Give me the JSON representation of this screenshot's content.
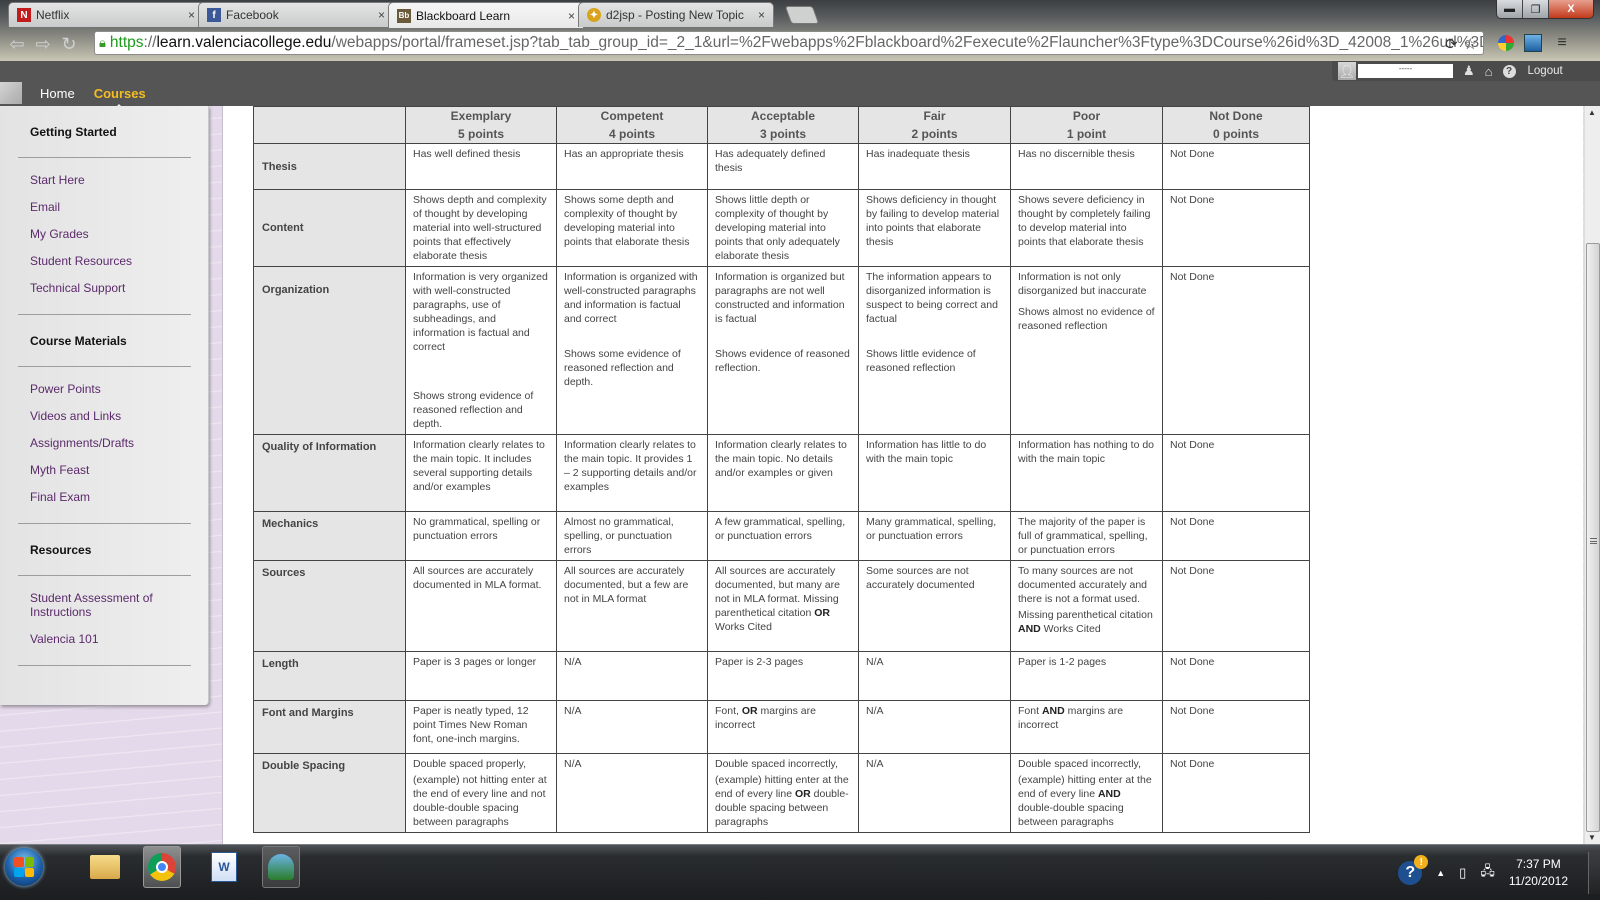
{
  "browser": {
    "tabs": [
      {
        "label": "Netflix",
        "icon": "netflix-icon",
        "active": false
      },
      {
        "label": "Facebook",
        "icon": "facebook-icon",
        "active": false
      },
      {
        "label": "Blackboard Learn",
        "icon": "blackboard-icon",
        "active": true
      },
      {
        "label": "d2jsp - Posting New Topic",
        "icon": "d2jsp-icon",
        "active": false
      }
    ],
    "tab_close": "×",
    "url": {
      "scheme": "https",
      "rest_scheme": "://",
      "host": "learn.valenciacollege.edu",
      "path": "/webapps/portal/frameset.jsp?tab_tab_group_id=_2_1&url=%2Fwebapps%2Fblackboard%2Fexecute%2Flauncher%3Ftype%3DCourse%26id%3D_42008_1%26url%3D"
    },
    "window_controls": {
      "minimize": "▬",
      "maximize": "❐",
      "close": "X"
    }
  },
  "blackboard": {
    "nav": [
      {
        "label": "Home",
        "active": false
      },
      {
        "label": "Courses",
        "active": true
      }
    ],
    "user_name": "-----",
    "logout_label": "Logout"
  },
  "sidebar": {
    "groups": [
      {
        "heading": "Getting Started",
        "items": [
          "Start Here",
          "Email",
          "My Grades",
          "Student Resources",
          "Technical Support"
        ]
      },
      {
        "heading": "Course Materials",
        "items": [
          "Power Points",
          "Videos and Links",
          "Assignments/Drafts",
          "Myth Feast",
          "Final Exam"
        ]
      },
      {
        "heading": "Resources",
        "items": [
          "Student Assessment of Instructions",
          "Valencia 101"
        ]
      }
    ]
  },
  "rubric": {
    "columns": [
      {
        "level": "Exemplary",
        "points": "5 points"
      },
      {
        "level": "Competent",
        "points": "4 points"
      },
      {
        "level": "Acceptable",
        "points": "3 points"
      },
      {
        "level": "Fair",
        "points": "2 points"
      },
      {
        "level": "Poor",
        "points": "1 point"
      },
      {
        "level": "Not Done",
        "points": "0 points"
      }
    ],
    "rows": [
      {
        "criterion": "Thesis",
        "cells": [
          "Has well defined thesis",
          "Has an appropriate thesis",
          "Has adequately defined thesis",
          "Has inadequate thesis",
          "Has no discernible thesis",
          "Not Done"
        ]
      },
      {
        "criterion": "Content",
        "cells": [
          "Shows depth and complexity of thought by developing material into well-structured points that effectively elaborate thesis",
          "Shows some depth and complexity of thought by developing material into points that elaborate thesis",
          "Shows little depth or complexity of thought by developing material into points that only adequately elaborate thesis",
          "Shows deficiency in thought by failing to develop material into points that elaborate thesis",
          "Shows severe deficiency in thought by completely failing to develop material into points that elaborate thesis",
          "Not Done"
        ]
      },
      {
        "criterion": "Organization",
        "cells": [
          [
            "Information is very organized with well-constructed paragraphs, use of subheadings, and information is factual and correct",
            "Shows strong evidence of reasoned reflection and depth."
          ],
          [
            "Information is organized with well-constructed paragraphs and information is factual and correct",
            "Shows some evidence of reasoned reflection and depth."
          ],
          [
            "Information is organized but paragraphs are not well constructed and information is factual",
            "Shows evidence of reasoned reflection."
          ],
          [
            "The information appears to disorganized information is suspect to being correct and factual",
            "Shows little evidence of reasoned reflection"
          ],
          [
            "Information is not only disorganized but inaccurate",
            "Shows almost no evidence of reasoned reflection"
          ],
          [
            "Not Done"
          ]
        ]
      },
      {
        "criterion": "Quality of Information",
        "cells": [
          "Information clearly relates to the main topic. It includes several supporting details and/or examples",
          "Information clearly relates to the main topic. It provides 1 – 2 supporting details and/or examples",
          "Information clearly relates to the main topic. No details and/or examples or given",
          "Information has little to do with the main topic",
          "Information has nothing to do with the main topic",
          "Not Done"
        ]
      },
      {
        "criterion": "Mechanics",
        "cells": [
          "No grammatical, spelling or punctuation errors",
          "Almost no grammatical, spelling, or punctuation errors",
          "A few grammatical, spelling, or punctuation errors",
          "Many grammatical, spelling, or punctuation errors",
          "The majority of the paper is full of grammatical, spelling, or punctuation errors",
          "Not Done"
        ]
      },
      {
        "criterion": "Sources",
        "cells": [
          "All sources are accurately documented in MLA format.",
          "All sources are accurately documented, but a few are not in MLA format",
          "All sources are accurately documented, but many are not in MLA format. Missing parenthetical citation OR Works Cited",
          "Some sources are not accurately documented",
          "To many sources are not documented accurately and there is not a format used.|Missing parenthetical citation AND Works Cited",
          "Not Done"
        ]
      },
      {
        "criterion": "Length",
        "cells": [
          "Paper is 3 pages or longer",
          "N/A",
          "Paper is 2-3 pages",
          "N/A",
          "Paper is 1-2 pages",
          "Not Done"
        ]
      },
      {
        "criterion": "Font and Margins",
        "cells": [
          "Paper is neatly typed, 12 point Times New Roman font, one-inch margins.",
          "N/A",
          "Font, OR margins are incorrect",
          "N/A",
          "Font AND margins are incorrect",
          "Not Done"
        ]
      },
      {
        "criterion": "Double Spacing",
        "cells": [
          "Double spaced properly,|(example) not hitting enter at the end of every line and not double-double spacing between paragraphs",
          "N/A",
          "Double spaced incorrectly,|(example) hitting enter at the end of every line OR double-double spacing between paragraphs",
          "N/A",
          "Double spaced incorrectly,|(example) hitting enter at the end of every line AND double-double spacing between paragraphs",
          "Not Done"
        ]
      }
    ]
  },
  "taskbar": {
    "apps": [
      "windows-explorer",
      "google-chrome",
      "microsoft-word",
      "windows-live-messenger"
    ],
    "clock_time": "7:37 PM",
    "clock_date": "11/20/2012"
  }
}
